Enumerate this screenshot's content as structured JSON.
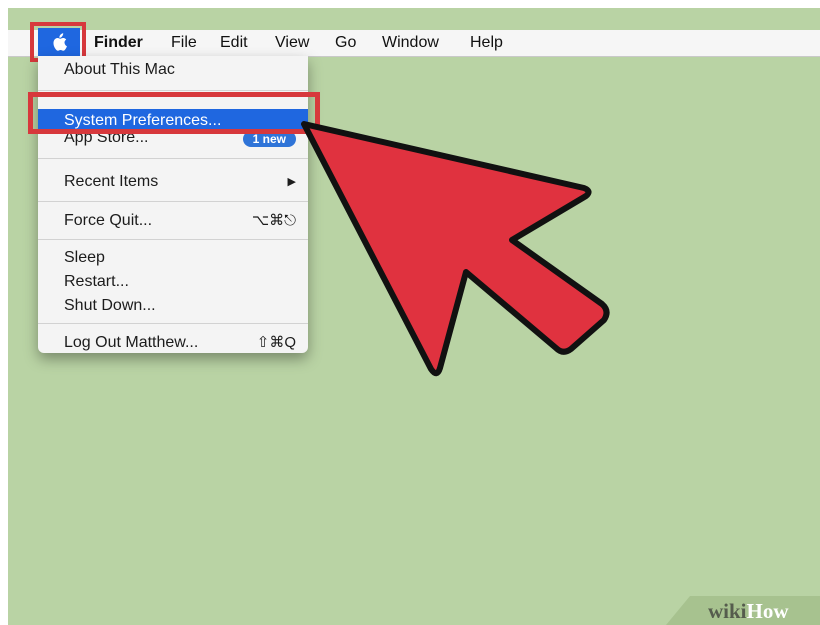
{
  "menubar": {
    "apple_icon": "apple-logo-icon",
    "items": [
      "Finder",
      "File",
      "Edit",
      "View",
      "Go",
      "Window",
      "Help"
    ]
  },
  "apple_menu": {
    "about": "About This Mac",
    "system_preferences": "System Preferences...",
    "app_store": "App Store...",
    "app_store_badge": "1 new",
    "recent_items": "Recent Items",
    "recent_items_arrow": "▶",
    "force_quit": "Force Quit...",
    "force_quit_shortcut": "⌥⌘⎋",
    "sleep": "Sleep",
    "restart": "Restart...",
    "shut_down": "Shut Down...",
    "log_out": "Log Out Matthew...",
    "log_out_shortcut": "⇧⌘Q"
  },
  "watermark": {
    "part1": "wiki",
    "part2": "How"
  },
  "colors": {
    "highlight": "#1f67e0",
    "annotation_red": "#d7383c",
    "desktop": "#b9d3a4"
  }
}
